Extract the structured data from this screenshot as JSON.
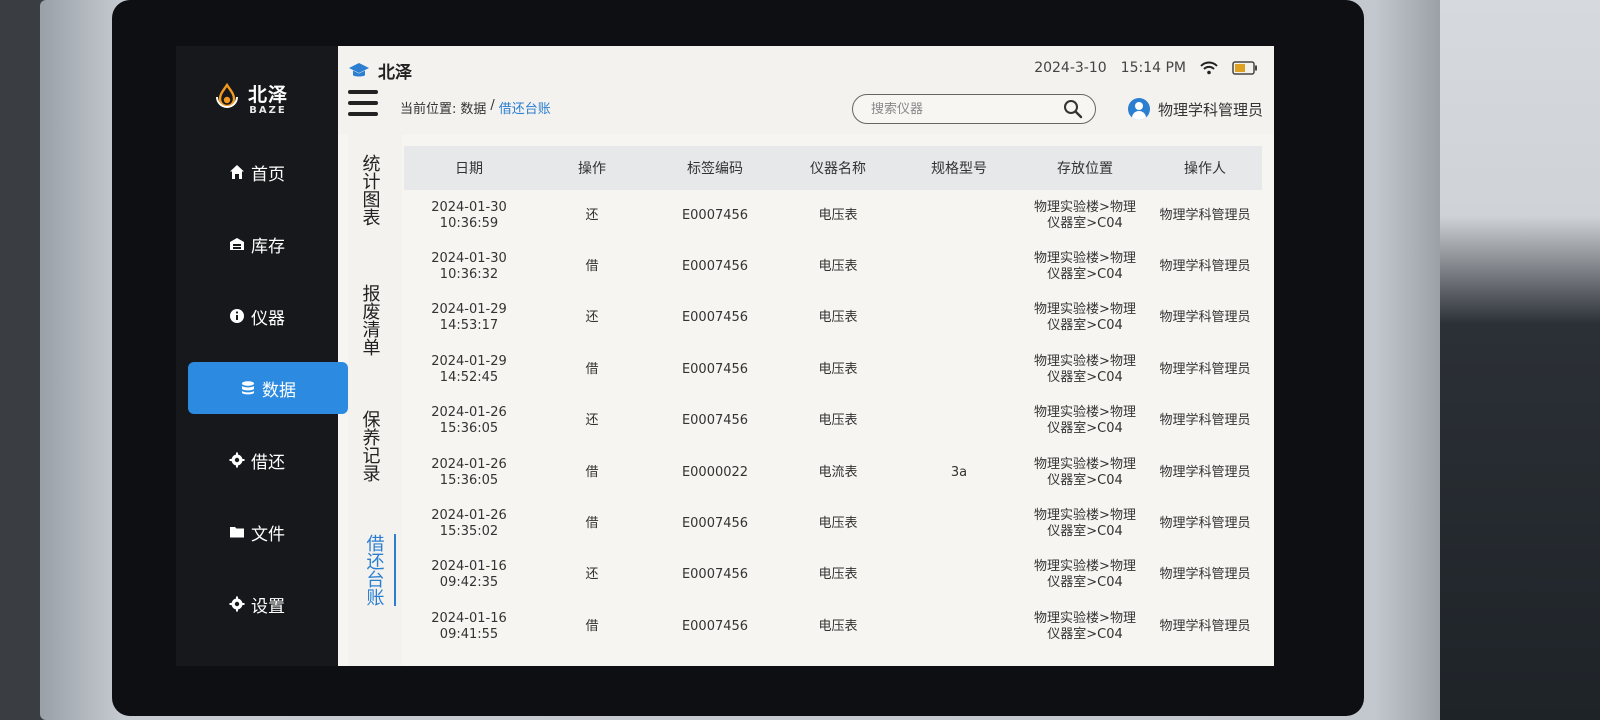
{
  "sidebar": {
    "logo_cn": "北泽",
    "logo_en": "BAZE",
    "items": [
      {
        "label": "首页",
        "icon": "home-icon"
      },
      {
        "label": "库存",
        "icon": "warehouse-icon"
      },
      {
        "label": "仪器",
        "icon": "info-icon"
      },
      {
        "label": "数据",
        "icon": "database-icon",
        "active": true
      },
      {
        "label": "借还",
        "icon": "gear-icon"
      },
      {
        "label": "文件",
        "icon": "folder-icon"
      },
      {
        "label": "设置",
        "icon": "settings-icon"
      }
    ]
  },
  "header": {
    "brand": "北泽",
    "date": "2024-3-10",
    "time": "15:14 PM",
    "breadcrumb_prefix": "当前位置:",
    "breadcrumb_parent": "数据",
    "breadcrumb_sep": "/",
    "breadcrumb_current": "借还台账",
    "search_placeholder": "搜索仪器",
    "user": "物理学科管理员"
  },
  "subtabs": [
    {
      "label": "统计图表"
    },
    {
      "label": "报废清单"
    },
    {
      "label": "保养记录"
    },
    {
      "label": "借还台账",
      "active": true
    }
  ],
  "table": {
    "headers": [
      "日期",
      "操作",
      "标签编码",
      "仪器名称",
      "规格型号",
      "存放位置",
      "操作人"
    ],
    "rows": [
      {
        "date": "2024-01-30",
        "time": "10:36:59",
        "op": "还",
        "code": "E0007456",
        "name": "电压表",
        "spec": "",
        "loc1": "物理实验楼>物理",
        "loc2": "仪器室>C04",
        "user": "物理学科管理员"
      },
      {
        "date": "2024-01-30",
        "time": "10:36:32",
        "op": "借",
        "code": "E0007456",
        "name": "电压表",
        "spec": "",
        "loc1": "物理实验楼>物理",
        "loc2": "仪器室>C04",
        "user": "物理学科管理员"
      },
      {
        "date": "2024-01-29",
        "time": "14:53:17",
        "op": "还",
        "code": "E0007456",
        "name": "电压表",
        "spec": "",
        "loc1": "物理实验楼>物理",
        "loc2": "仪器室>C04",
        "user": "物理学科管理员"
      },
      {
        "date": "2024-01-29",
        "time": "14:52:45",
        "op": "借",
        "code": "E0007456",
        "name": "电压表",
        "spec": "",
        "loc1": "物理实验楼>物理",
        "loc2": "仪器室>C04",
        "user": "物理学科管理员"
      },
      {
        "date": "2024-01-26",
        "time": "15:36:05",
        "op": "还",
        "code": "E0007456",
        "name": "电压表",
        "spec": "",
        "loc1": "物理实验楼>物理",
        "loc2": "仪器室>C04",
        "user": "物理学科管理员"
      },
      {
        "date": "2024-01-26",
        "time": "15:36:05",
        "op": "借",
        "code": "E0000022",
        "name": "电流表",
        "spec": "3a",
        "loc1": "物理实验楼>物理",
        "loc2": "仪器室>C04",
        "user": "物理学科管理员"
      },
      {
        "date": "2024-01-26",
        "time": "15:35:02",
        "op": "借",
        "code": "E0007456",
        "name": "电压表",
        "spec": "",
        "loc1": "物理实验楼>物理",
        "loc2": "仪器室>C04",
        "user": "物理学科管理员"
      },
      {
        "date": "2024-01-16",
        "time": "09:42:35",
        "op": "还",
        "code": "E0007456",
        "name": "电压表",
        "spec": "",
        "loc1": "物理实验楼>物理",
        "loc2": "仪器室>C04",
        "user": "物理学科管理员"
      },
      {
        "date": "2024-01-16",
        "time": "09:41:55",
        "op": "借",
        "code": "E0007456",
        "name": "电压表",
        "spec": "",
        "loc1": "物理实验楼>物理",
        "loc2": "仪器室>C04",
        "user": "物理学科管理员"
      }
    ]
  },
  "colors": {
    "accent": "#2c8be0",
    "sidebar_bg": "#16181c",
    "header_row_bg": "#e6e8ea",
    "battery": "#e0a020"
  }
}
